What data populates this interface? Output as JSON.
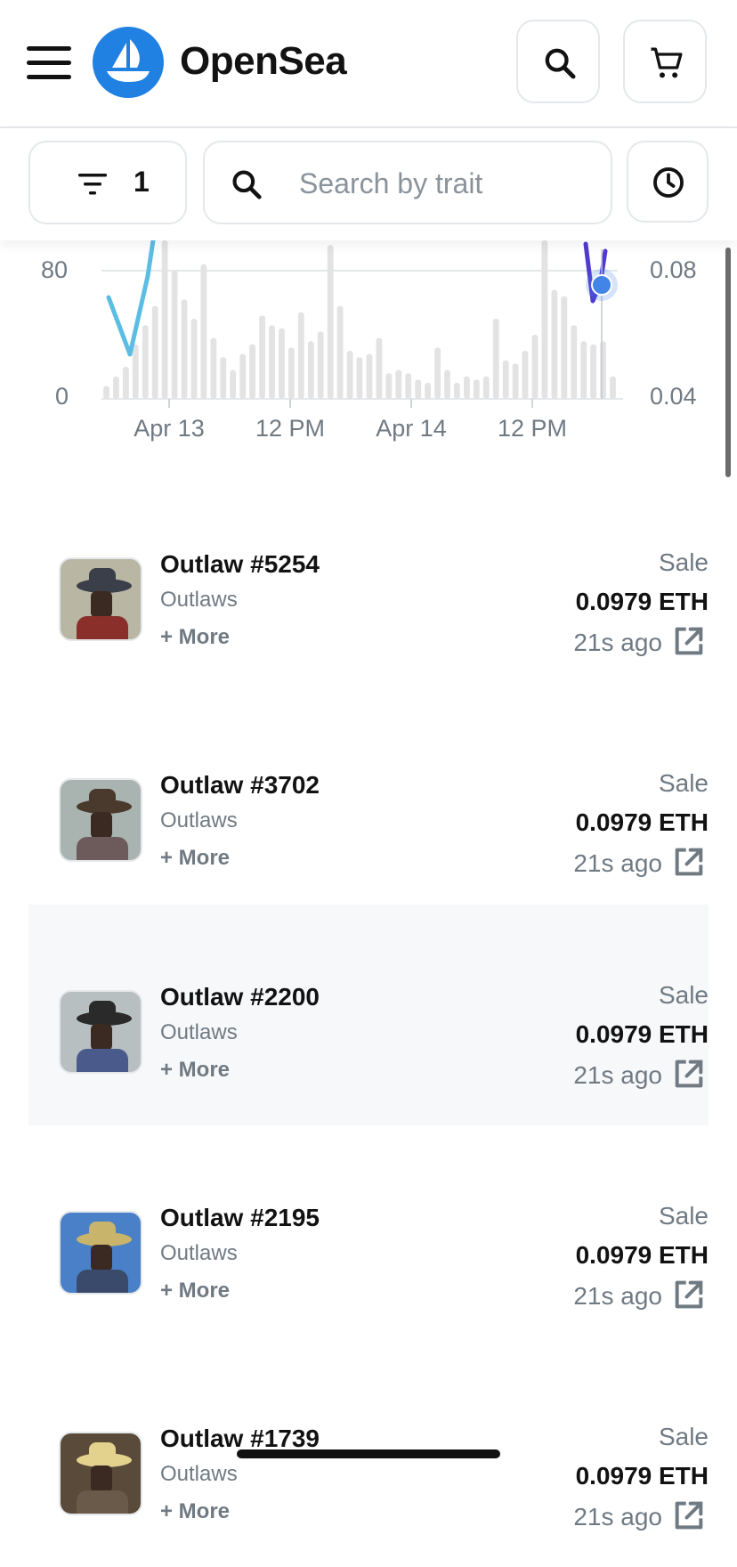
{
  "header": {
    "brand": "OpenSea",
    "brand_color": "#2081e2",
    "menu_icon": "hamburger-icon",
    "search_icon": "search-icon",
    "cart_icon": "cart-icon"
  },
  "filterbar": {
    "filter_icon": "filter-lines-icon",
    "filter_count": "1",
    "search_placeholder": "Search by trait",
    "search_value": "",
    "history_icon": "clock-icon"
  },
  "chart_data": {
    "type": "bar",
    "left_axis_ticks": [
      "80",
      "0"
    ],
    "right_axis_ticks": [
      "0.08",
      "0.04"
    ],
    "x_ticks": [
      "Apr 13",
      "12 PM",
      "Apr 14",
      "12 PM"
    ],
    "volume_values": [
      8,
      14,
      20,
      34,
      46,
      58,
      100,
      80,
      62,
      50,
      84,
      38,
      26,
      18,
      28,
      34,
      52,
      46,
      44,
      32,
      54,
      36,
      42,
      96,
      58,
      30,
      26,
      28,
      38,
      16,
      18,
      16,
      12,
      10,
      32,
      18,
      10,
      14,
      12,
      14,
      50,
      24,
      22,
      30,
      40,
      100,
      68,
      64,
      46,
      36,
      34,
      36,
      14
    ],
    "volume_ylim": [
      0,
      80
    ],
    "price_ylim": [
      0.04,
      0.08
    ],
    "series_colors": [
      "#5bbde4",
      "#4f3bd1"
    ],
    "highlight_color": "#4285e6"
  },
  "events": [
    {
      "name": "Outlaw #5254",
      "collection": "Outlaws",
      "more": "+ More",
      "type": "Sale",
      "price": "0.0979 ETH",
      "time": "21s ago",
      "palette": {
        "sky": "#b9b6a4",
        "hat": "#3b3f4a",
        "body": "#8a2f2a"
      }
    },
    {
      "name": "Outlaw #3702",
      "collection": "Outlaws",
      "more": "+ More",
      "type": "Sale",
      "price": "0.0979 ETH",
      "time": "21s ago",
      "palette": {
        "sky": "#a9b3b0",
        "hat": "#4a3a2e",
        "body": "#6d5a5a"
      }
    },
    {
      "name": "Outlaw #2200",
      "collection": "Outlaws",
      "more": "+ More",
      "type": "Sale",
      "price": "0.0979 ETH",
      "time": "21s ago",
      "palette": {
        "sky": "#b7bfc1",
        "hat": "#2a2a2a",
        "body": "#4a5a8a"
      }
    },
    {
      "name": "Outlaw #2195",
      "collection": "Outlaws",
      "more": "+ More",
      "type": "Sale",
      "price": "0.0979 ETH",
      "time": "21s ago",
      "palette": {
        "sky": "#4a80c8",
        "hat": "#c8b46a",
        "body": "#3a4a6a"
      }
    },
    {
      "name": "Outlaw #1739",
      "collection": "Outlaws",
      "more": "+ More",
      "type": "Sale",
      "price": "0.0979 ETH",
      "time": "21s ago",
      "palette": {
        "sky": "#5a4a3a",
        "hat": "#e2d28e",
        "body": "#6a5a4a"
      }
    }
  ]
}
